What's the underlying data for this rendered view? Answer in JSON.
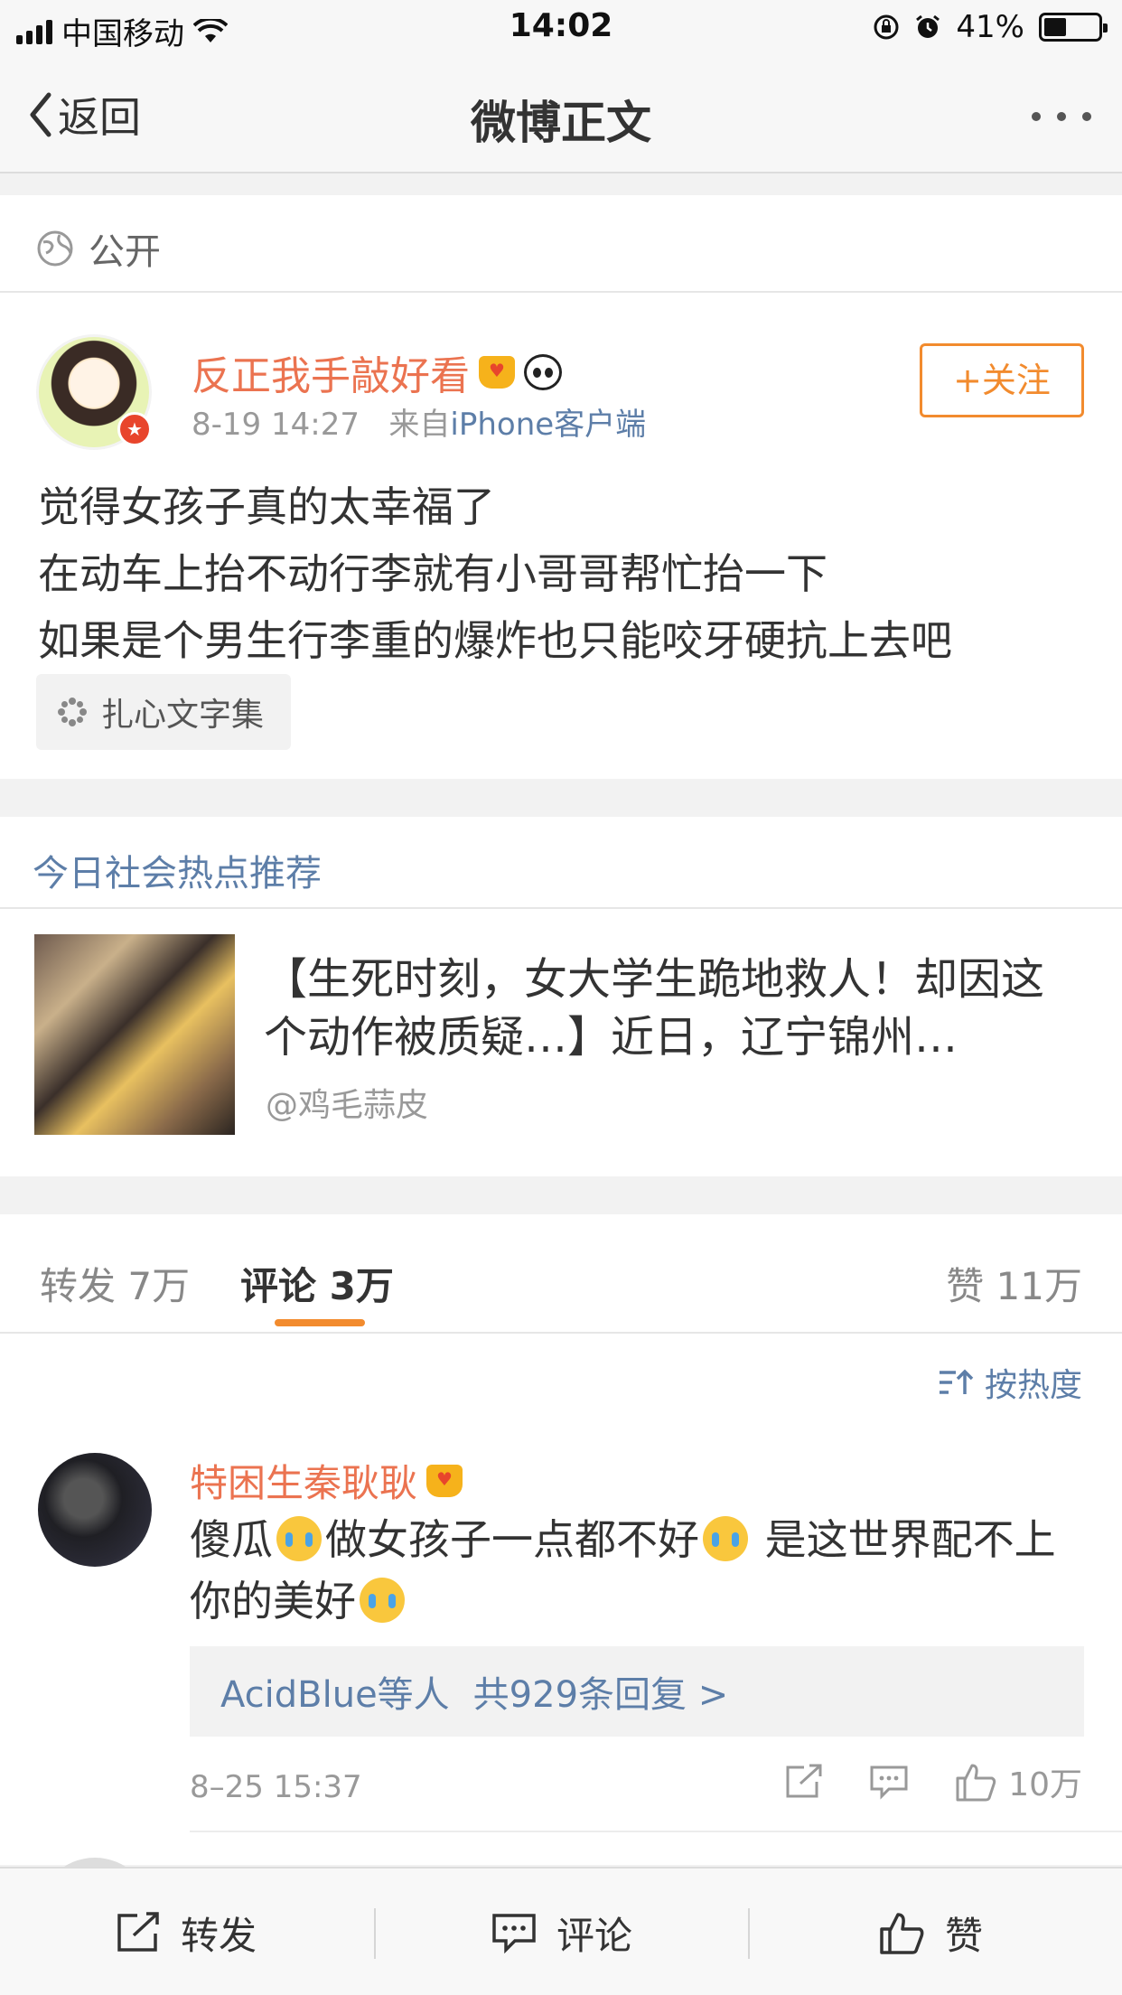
{
  "status_bar": {
    "carrier": "中国移动",
    "time": "14:02",
    "battery": "41%",
    "battery_level": 0.41
  },
  "nav": {
    "back_label": "返回",
    "title": "微博正文"
  },
  "visibility": {
    "label": "公开"
  },
  "post": {
    "username": "反正我手敲好看",
    "time": "8-19 14:27",
    "source_prefix": "来自",
    "source": "iPhone客户端",
    "follow_label": "+关注",
    "lines": [
      "觉得女孩子真的太幸福了",
      "在动车上抬不动行李就有小哥哥帮忙抬一下",
      "如果是个男生行李重的爆炸也只能咬牙硬抗上去吧"
    ],
    "topic": "扎心文字集"
  },
  "hot": {
    "header": "今日社会热点推荐",
    "title": "【生死时刻，女大学生跪地救人！却因这个动作被质疑…】近日，辽宁锦州…",
    "source": "@鸡毛蒜皮"
  },
  "tabs": {
    "repost": "转发 7万",
    "comment": "评论 3万",
    "like": "赞 11万"
  },
  "sort_label": "按热度",
  "comment": {
    "username": "特困生秦耿耿",
    "text_1": "傻瓜",
    "text_2": "做女孩子一点都不好",
    "text_3": "是这世界配不上你的美好",
    "reply_user": "AcidBlue等人",
    "reply_count": "共929条回复 >",
    "time": "8–25 15:37",
    "likes": "10万"
  },
  "bottom_bar": {
    "repost": "转发",
    "comment": "评论",
    "like": "赞"
  }
}
